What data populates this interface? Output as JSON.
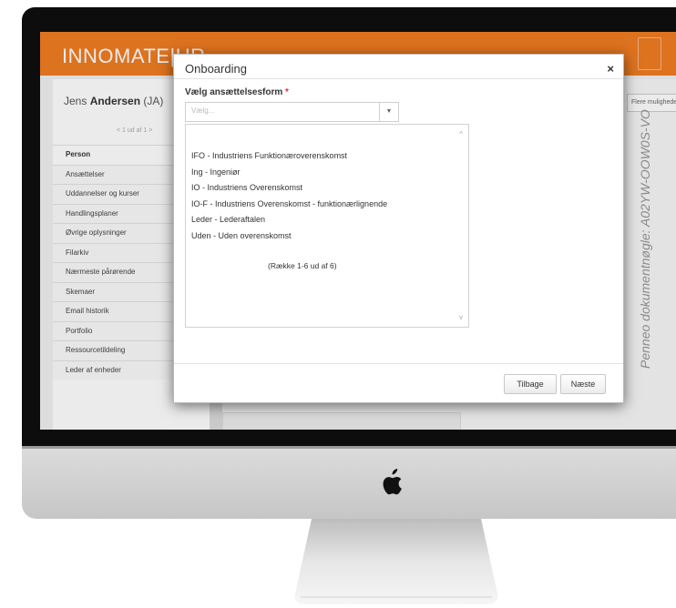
{
  "app": {
    "logo": "INNOMATE|HR",
    "user_name": "Jens ",
    "user_surname": "Andersen",
    "user_initials": "(JA)",
    "pager": "< 1 ud af 1 >",
    "right_field": "Flere muligheder"
  },
  "sidebar": {
    "header": "Person",
    "items": [
      {
        "label": "Ansættelser"
      },
      {
        "label": "Uddannelser og kurser"
      },
      {
        "label": "Handlingsplaner"
      },
      {
        "label": "Øvrige oplysninger"
      },
      {
        "label": "Filarkiv"
      },
      {
        "label": "Nærmeste pårørende"
      },
      {
        "label": "Skemaer"
      },
      {
        "label": "Email historik"
      },
      {
        "label": "Portfolio"
      },
      {
        "label": "Ressourcetildeling"
      },
      {
        "label": "Leder af enheder"
      }
    ]
  },
  "modal": {
    "title": "Onboarding",
    "close_glyph": "×",
    "field_label": "Vælg ansættelsesform",
    "required_mark": "*",
    "select_placeholder": "Vælg...",
    "options": [
      {
        "label": "IFO - Industriens Funktionæroverenskomst"
      },
      {
        "label": "Ing - Ingeniør"
      },
      {
        "label": "IO - Industriens Overenskomst"
      },
      {
        "label": "IO-F - Industriens Overenskomst - funktionærlignende"
      },
      {
        "label": "Leder - Lederaftalen"
      },
      {
        "label": "Uden - Uden overenskomst"
      }
    ],
    "count_text": "(Række 1-6 ud af 6)",
    "back_button": "Tilbage",
    "next_button": "Næste"
  },
  "watermark": "Penneo dokumentnøgle: A02YW-OOW0S-VO",
  "colors": {
    "brand_orange": "#f07c22",
    "required_red": "#e03030",
    "bezel": "#0d0d0d"
  },
  "icons": {
    "apple": "apple-logo-icon",
    "close": "close-icon",
    "dropdown": "chevron-down-icon"
  }
}
